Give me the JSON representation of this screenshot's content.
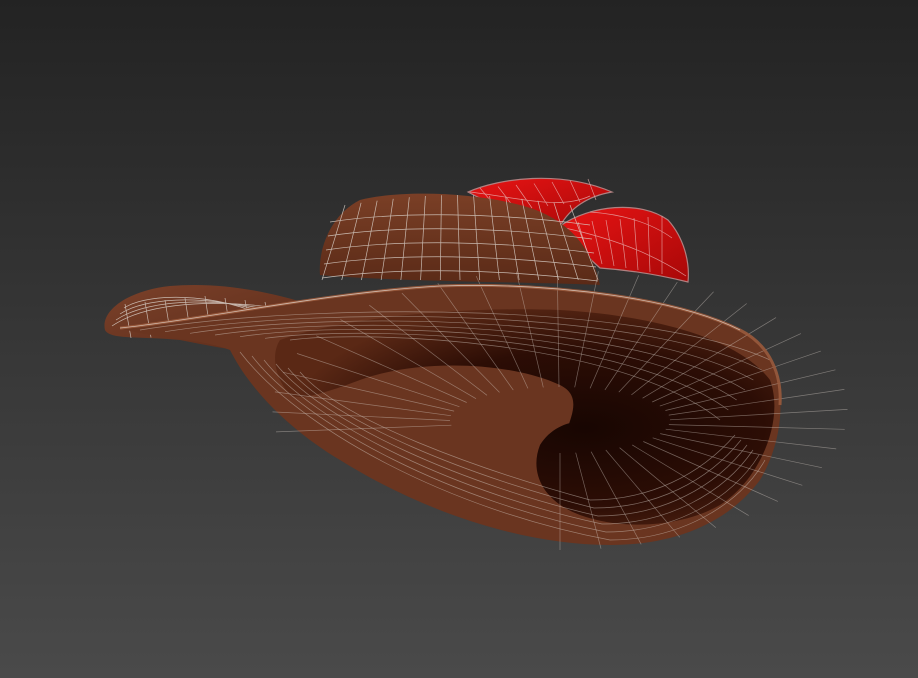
{
  "viewport": {
    "background_top": "#232323",
    "background_bottom": "#4a4a4a"
  },
  "model": {
    "object": "hat",
    "display_mode": "shaded-with-wireframe",
    "colors": {
      "hat_body": "#6a3520",
      "hat_dark": "#220a04",
      "hat_highlight": "#8a4a2e",
      "feather": "#d41010",
      "feather_dark": "#8a0606",
      "wireframe": "#d9d0c8"
    }
  }
}
